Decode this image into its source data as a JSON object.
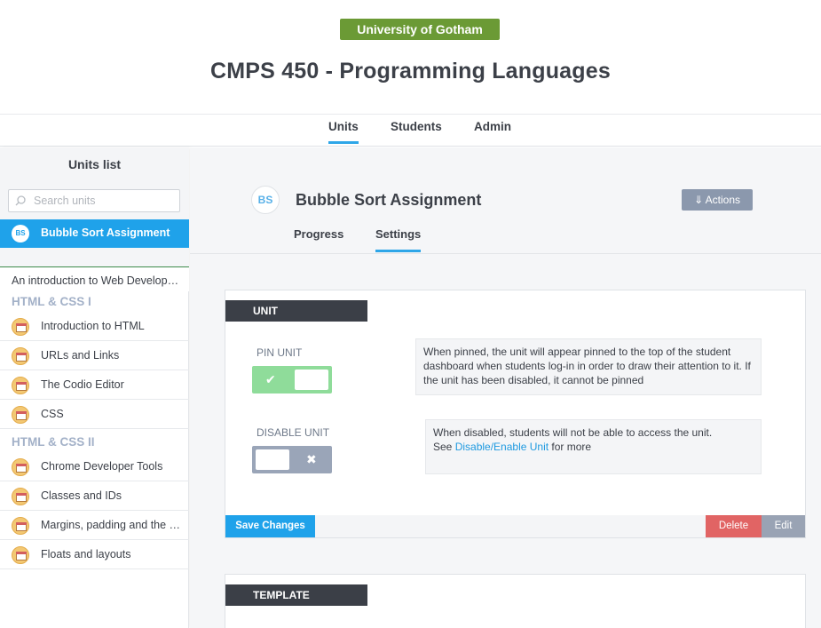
{
  "org": {
    "name": "University of Gotham",
    "color": "#6b9a35"
  },
  "course": {
    "title": "CMPS 450 - Programming Languages"
  },
  "topnav": {
    "units": "Units",
    "students": "Students",
    "admin": "Admin"
  },
  "sidebar": {
    "title": "Units list",
    "search_placeholder": "Search units",
    "selected": {
      "initials": "BS",
      "label": "Bubble Sort Assignment"
    },
    "course_link": "An introduction to Web Development",
    "sections": [
      {
        "title": "HTML & CSS I",
        "items": [
          "Introduction to HTML",
          "URLs and Links",
          "The Codio Editor",
          "CSS"
        ]
      },
      {
        "title": "HTML & CSS II",
        "items": [
          "Chrome Developer Tools",
          "Classes and IDs",
          "Margins, padding and the box model",
          "Floats and layouts"
        ]
      }
    ]
  },
  "unit": {
    "initials": "BS",
    "title": "Bubble Sort Assignment",
    "actions_label": "⇓ Actions",
    "tabs": {
      "progress": "Progress",
      "settings": "Settings"
    }
  },
  "unit_card": {
    "tag": "UNIT",
    "pin": {
      "label": "PIN UNIT",
      "state": "on",
      "help": "When pinned, the unit will appear pinned to the top of the student dashboard when students log-in in order to draw their attention to it. If the unit has been disabled, it cannot be pinned"
    },
    "disable": {
      "label": "DISABLE UNIT",
      "state": "off",
      "help_line1": "When disabled, students will not be able to access the unit.",
      "help_see": "See ",
      "help_link": "Disable/Enable Unit",
      "help_after": " for more"
    },
    "save_label": "Save Changes",
    "delete_label": "Delete",
    "edit_label": "Edit"
  },
  "template_card": {
    "tag": "TEMPLATE"
  },
  "colors": {
    "accent": "#1fa2ea",
    "danger": "#e16464",
    "toggle_on": "#8fdc9a"
  }
}
